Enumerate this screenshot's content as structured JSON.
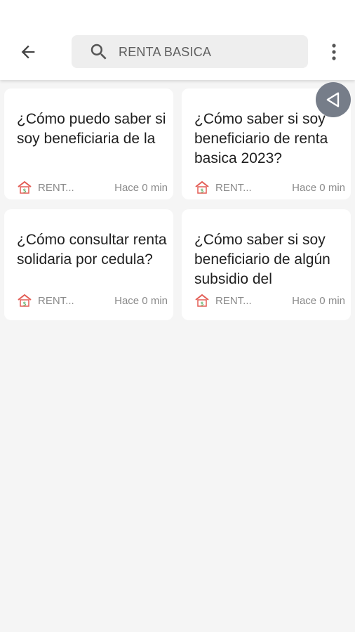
{
  "header": {
    "back_icon": "arrow-left-icon",
    "search_icon": "search-icon",
    "search_query": "RENTA BASICA",
    "menu_icon": "more-vertical-icon"
  },
  "fab": {
    "icon": "triangle-left-icon"
  },
  "articles": [
    {
      "title": "¿Cómo puedo saber si soy beneficiaria de la",
      "source": "RENT...",
      "time": "Hace 0 min"
    },
    {
      "title": "¿Cómo saber si soy beneficiario de renta basica 2023?",
      "source": "RENT...",
      "time": "Hace 0 min"
    },
    {
      "title": "¿Cómo consultar renta solidaria por cedula?",
      "source": "RENT...",
      "time": "Hace 0 min"
    },
    {
      "title": "¿Cómo saber si soy beneficiario de algún subsidio del",
      "source": "RENT...",
      "time": "Hace 0 min"
    }
  ],
  "colors": {
    "background": "#f5f5f5",
    "card": "#ffffff",
    "source_icon_red": "#e35d55",
    "source_icon_green": "#3ea34a",
    "fab": "#6b7280"
  }
}
